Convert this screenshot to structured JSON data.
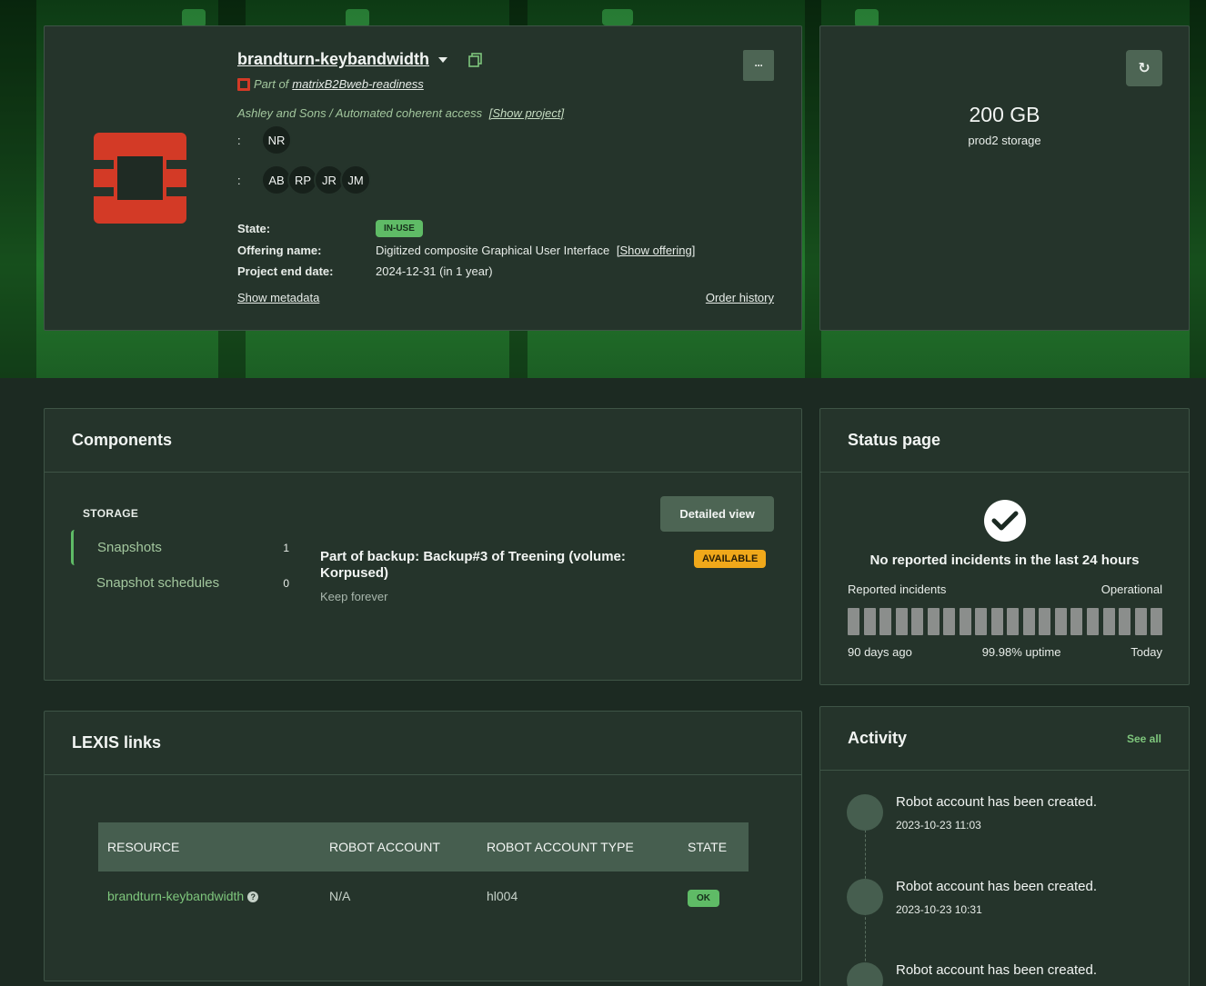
{
  "resource": {
    "name": "brandturn-keybandwidth",
    "part_of_prefix": "Part of",
    "parent": "matrixB2Bweb-readiness",
    "org_project": "Ashley and Sons / Automated coherent access",
    "show_project": "[Show project]",
    "colon": ":",
    "owners": [
      "NR"
    ],
    "members": [
      "AB",
      "RP",
      "JR",
      "JM"
    ],
    "state_label": "State:",
    "state_value": "IN-USE",
    "offering_label": "Offering name:",
    "offering_value": "Digitized composite Graphical User Interface",
    "show_offering": "[Show offering]",
    "end_date_label": "Project end date:",
    "end_date_value": "2024-12-31 (in 1 year)",
    "show_metadata": "Show metadata",
    "order_history": "Order history",
    "more_label": "···"
  },
  "storage": {
    "size": "200 GB",
    "label": "prod2 storage"
  },
  "components": {
    "title": "Components",
    "section": "STORAGE",
    "items": [
      {
        "label": "Snapshots",
        "count": "1"
      },
      {
        "label": "Snapshot schedules",
        "count": "0"
      }
    ],
    "detailed_view": "Detailed view",
    "backup_title": "Part of backup: Backup#3 of Treening (volume: Korpused)",
    "backup_sub": "Keep forever",
    "backup_status": "AVAILABLE"
  },
  "status_page": {
    "title": "Status page",
    "message": "No reported incidents in the last 24 hours",
    "left_label": "Reported incidents",
    "right_label": "Operational",
    "from": "90 days ago",
    "uptime": "99.98% uptime",
    "to": "Today",
    "bar_count": 20,
    "bar_color": "#8b8e8c"
  },
  "lexis": {
    "title": "LEXIS links",
    "columns": [
      "RESOURCE",
      "ROBOT ACCOUNT",
      "ROBOT ACCOUNT TYPE",
      "STATE"
    ],
    "rows": [
      {
        "resource": "brandturn-keybandwidth",
        "robot_account": "N/A",
        "type": "hl004",
        "state": "OK"
      }
    ]
  },
  "activity": {
    "title": "Activity",
    "see_all": "See all",
    "items": [
      {
        "text": "Robot account has been created.",
        "time": "2023-10-23 11:03"
      },
      {
        "text": "Robot account has been created.",
        "time": "2023-10-23 10:31"
      },
      {
        "text": "Robot account has been created.",
        "time": ""
      }
    ]
  },
  "colors": {
    "accent_green": "#5fbb66",
    "brand_red": "#d33a26",
    "warning_orange": "#f0a81a",
    "card_bg": "#25342b"
  }
}
